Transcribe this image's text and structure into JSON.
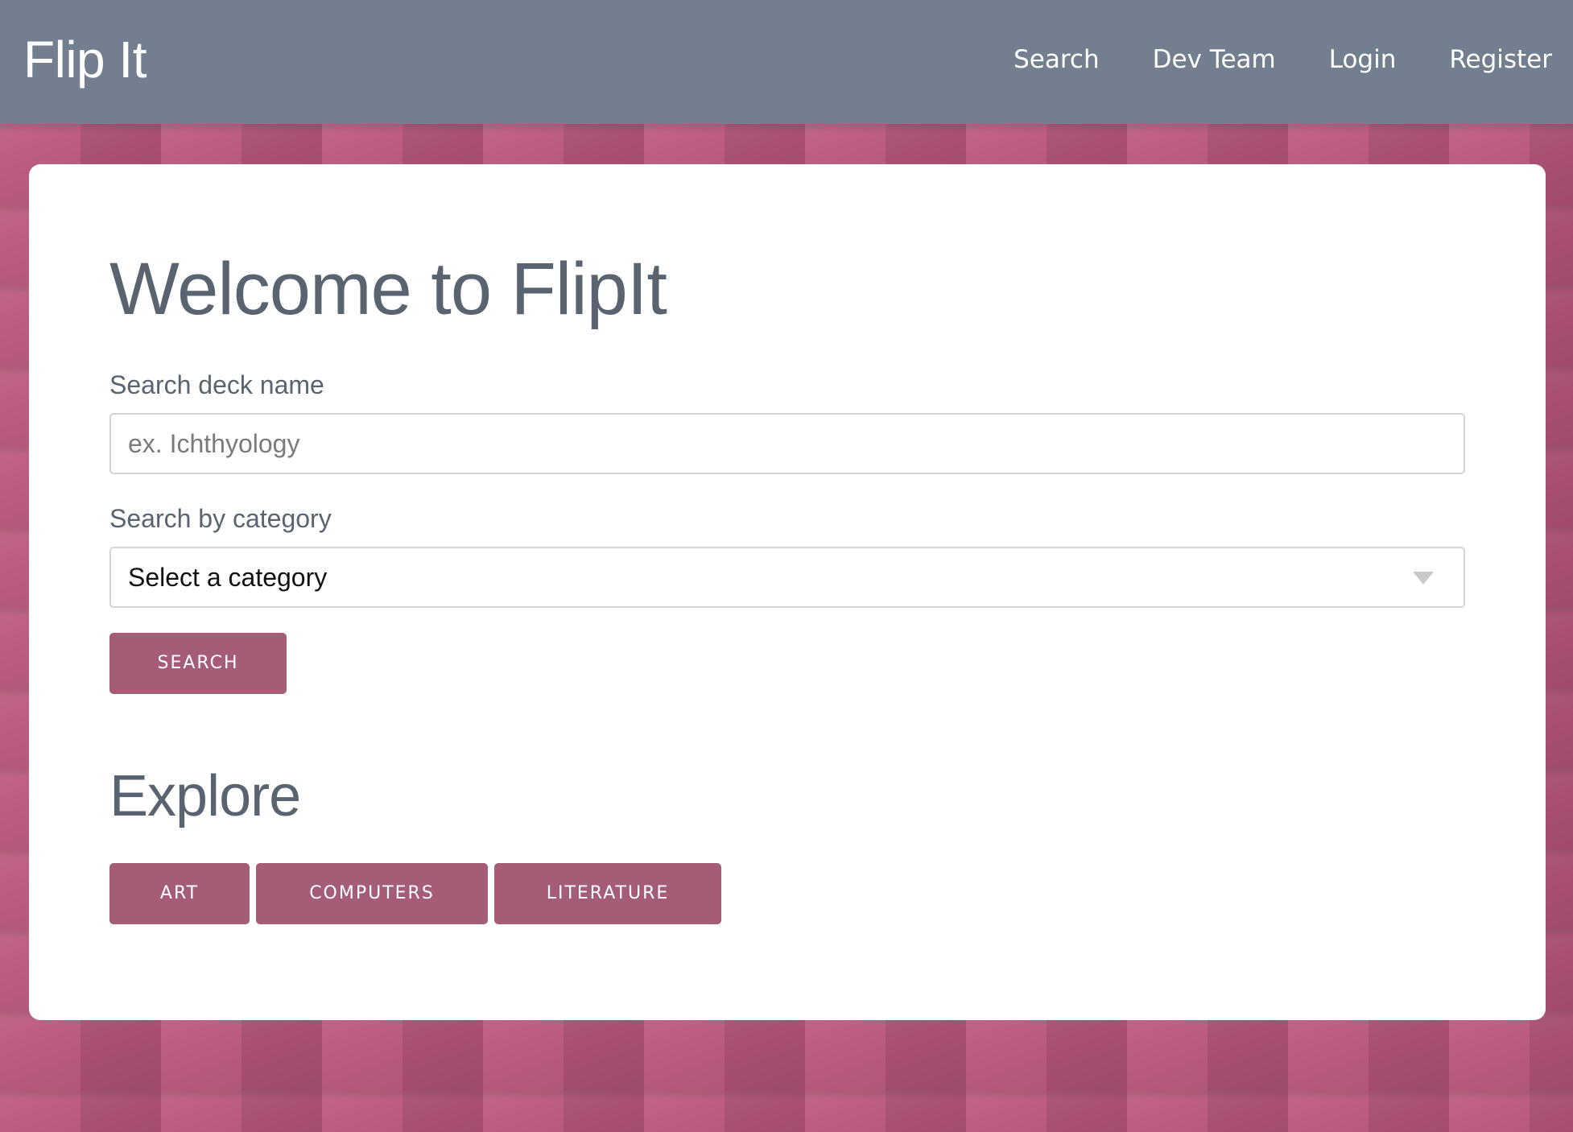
{
  "navbar": {
    "brand": "Flip It",
    "links": [
      "Search",
      "Dev Team",
      "Login",
      "Register"
    ]
  },
  "main": {
    "title": "Welcome to FlipIt",
    "deck_search": {
      "label": "Search deck name",
      "placeholder": "ex. Ichthyology",
      "value": ""
    },
    "category_search": {
      "label": "Search by category",
      "selected": "Select a category"
    },
    "search_button": "SEARCH",
    "explore": {
      "heading": "Explore",
      "categories": [
        "ART",
        "COMPUTERS",
        "LITERATURE"
      ]
    }
  },
  "colors": {
    "navbar": "#737f8e",
    "accent_button": "#a55c76",
    "background_pattern": "#b65a7e",
    "heading_text": "#5a6470"
  },
  "icons": {
    "select_caret": "chevron-down-icon"
  }
}
